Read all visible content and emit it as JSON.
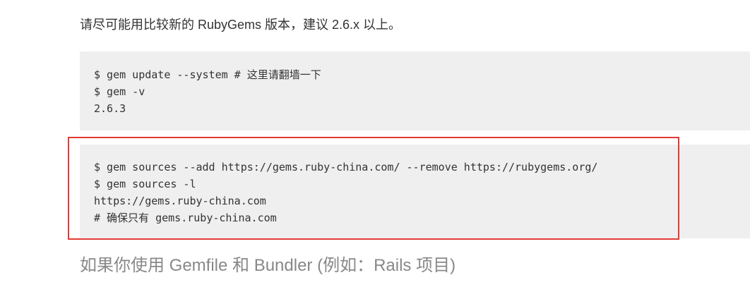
{
  "intro_text": "请尽可能用比较新的 RubyGems 版本，建议 2.6.x 以上。",
  "code_block_1": {
    "lines": [
      "$ gem update --system # 这里请翻墙一下",
      "$ gem -v",
      "2.6.3"
    ]
  },
  "code_block_2": {
    "lines": [
      "$ gem sources --add https://gems.ruby-china.com/ --remove https://rubygems.org/",
      "$ gem sources -l",
      "https://gems.ruby-china.com",
      "# 确保只有 gems.ruby-china.com"
    ]
  },
  "section_heading": "如果你使用 Gemfile 和 Bundler (例如：Rails 项目)",
  "colors": {
    "code_background": "#efefef",
    "highlight_border": "#e53935",
    "heading_text": "#888888",
    "body_text": "#333333"
  }
}
